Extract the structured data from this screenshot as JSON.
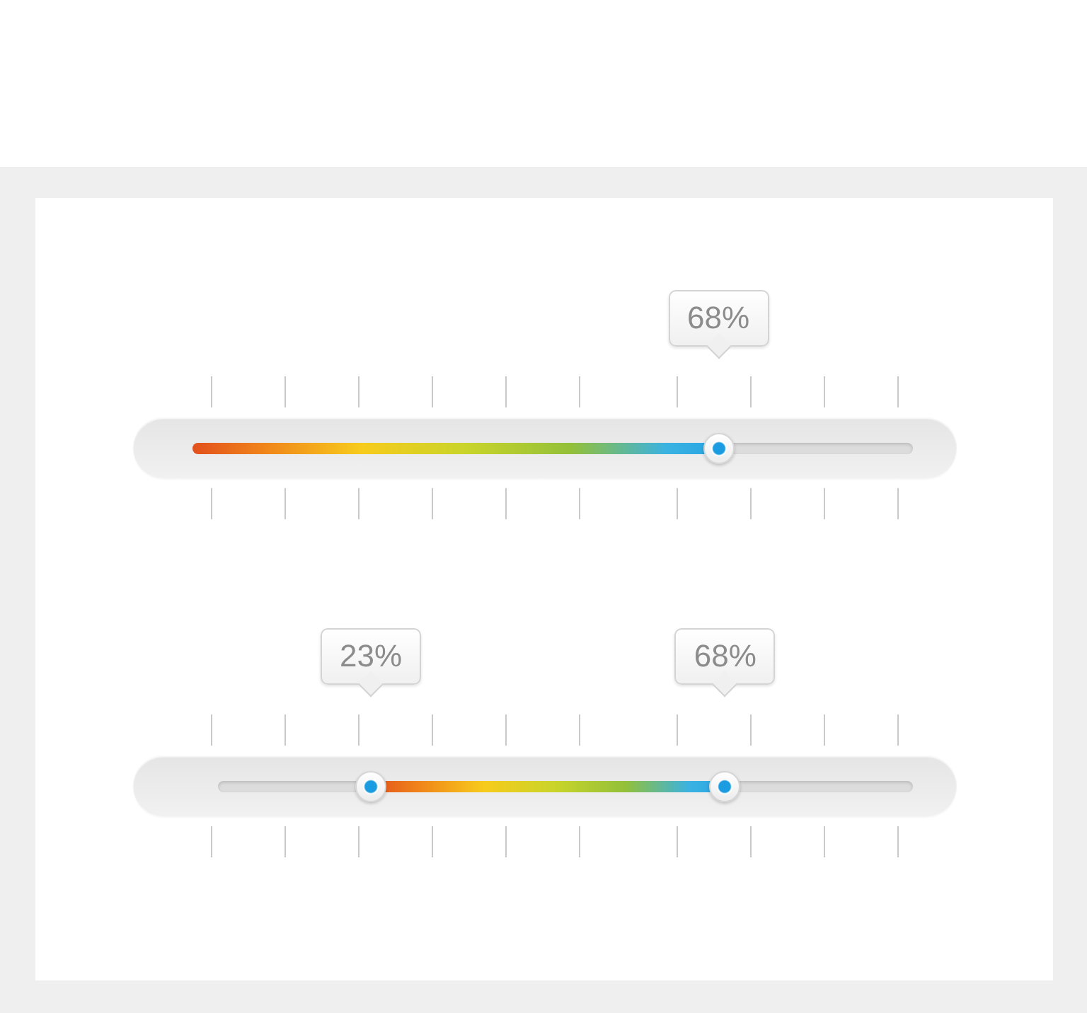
{
  "sliders": [
    {
      "kind": "single",
      "thumbs": [
        {
          "level": 0.73,
          "reading": "68%"
        }
      ]
    },
    {
      "kind": "range",
      "thumbs": [
        {
          "level": 0.22,
          "reading": "23%"
        },
        {
          "level": 0.73,
          "reading": "68%"
        }
      ]
    }
  ]
}
